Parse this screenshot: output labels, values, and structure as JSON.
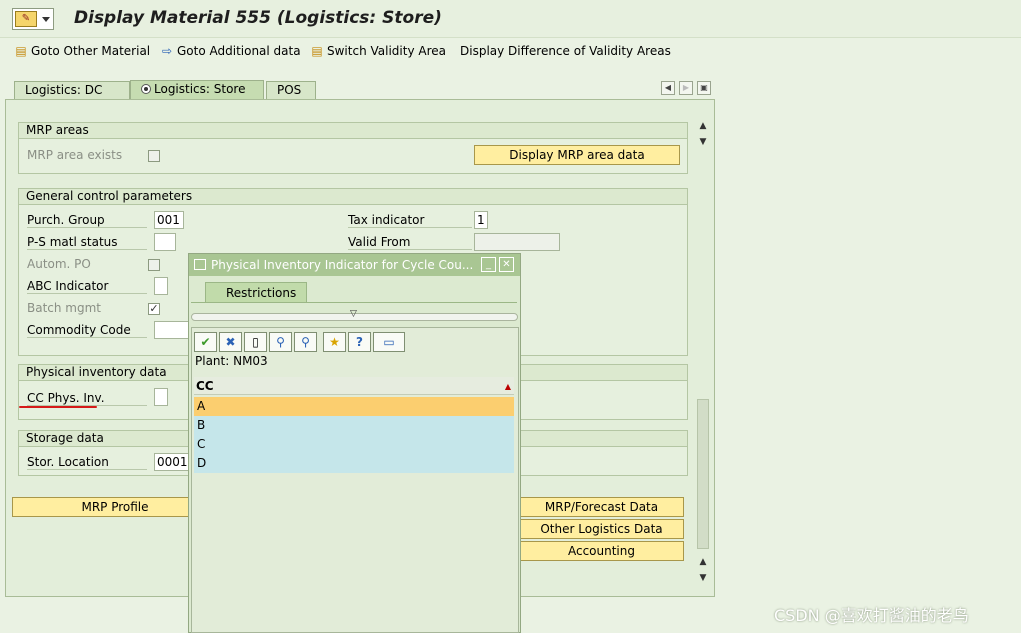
{
  "window": {
    "title": "Display Material 555 (Logistics: Store)"
  },
  "toolbar": {
    "goto_other_material": "Goto Other Material",
    "goto_additional_data": "Goto Additional data",
    "switch_validity_area": "Switch Validity Area",
    "display_difference": "Display Difference of Validity Areas"
  },
  "tabs": [
    {
      "label": "Logistics: DC"
    },
    {
      "label": "Logistics: Store",
      "active": true
    },
    {
      "label": "POS"
    }
  ],
  "mrp_areas": {
    "title": "MRP areas",
    "mrp_area_exists_label": "MRP area exists",
    "mrp_area_exists_checked": false,
    "display_button": "Display MRP area data"
  },
  "general_control": {
    "title": "General control parameters",
    "purch_group_label": "Purch. Group",
    "purch_group_value": "001",
    "ps_matl_status_label": "P-S matl status",
    "ps_matl_status_value": "",
    "autom_po_label": "Autom. PO",
    "abc_indicator_label": "ABC Indicator",
    "batch_mgmt_label": "Batch mgmt",
    "batch_mgmt_checked": true,
    "commodity_code_label": "Commodity Code",
    "tax_indicator_label": "Tax indicator",
    "tax_indicator_value": "1",
    "valid_from_label": "Valid From",
    "valid_from_value": ""
  },
  "physical_inventory": {
    "title": "Physical inventory data",
    "cc_phys_inv_label": "CC Phys. Inv."
  },
  "storage": {
    "title": "Storage data",
    "stor_location_label": "Stor. Location",
    "stor_location_value": "0001"
  },
  "bottom_buttons": {
    "mrp_profile": "MRP Profile",
    "mrp_forecast": "MRP/Forecast Data",
    "other_logistics": "Other Logistics Data",
    "accounting": "Accounting"
  },
  "popup": {
    "title": "Physical Inventory Indicator for Cycle Cou...",
    "restrictions_tab": "Restrictions",
    "plant_label": "Plant: NM03",
    "column_header": "CC",
    "rows": [
      "A",
      "B",
      "C",
      "D"
    ],
    "selected_row": "A",
    "toolbar_icons": [
      "check-icon",
      "cancel-icon",
      "new-document-icon",
      "find-icon",
      "find-next-icon",
      "favorites-icon",
      "help-icon",
      "print-icon"
    ]
  },
  "watermark": "CSDN @喜欢打酱油的老鸟",
  "colors": {
    "background": "#eaf2e3",
    "button_yellow": "#ffeea0",
    "popup_title": "#a9c693",
    "selected_row": "#fbce6f",
    "row_bg": "#c5e6ea",
    "annotation_red": "#d51a1a"
  }
}
